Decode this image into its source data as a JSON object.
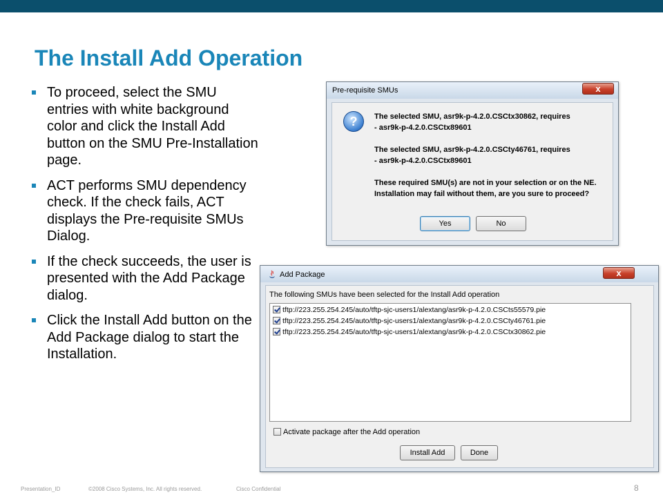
{
  "slide": {
    "title": "The Install Add Operation",
    "bullets": [
      "To proceed, select the SMU entries with white background color and click the Install Add button on the SMU Pre-Installation page.",
      "ACT performs SMU dependency check.  If the check fails, ACT displays the Pre-requisite SMUs Dialog.",
      "If the check succeeds, the user is presented with the Add Package dialog.",
      "Click the Install Add button on the Add Package dialog to start the Installation."
    ],
    "accent_color": "#1a86b8",
    "top_bar_color": "#0b4f6c"
  },
  "prereq_dialog": {
    "title": "Pre-requisite SMUs",
    "close_label": "x",
    "icon": "question-icon",
    "icon_glyph": "?",
    "messages": [
      "The selected SMU, asr9k-p-4.2.0.CSCtx30862, requires",
      " - asr9k-p-4.2.0.CSCtx89601",
      "The selected SMU, asr9k-p-4.2.0.CSCty46761, requires",
      " - asr9k-p-4.2.0.CSCtx89601",
      "These required SMU(s) are not in your selection or on the NE.",
      "Installation may fail without them, are you sure to proceed?"
    ],
    "yes_label": "Yes",
    "no_label": "No"
  },
  "add_package_dialog": {
    "title": "Add Package",
    "close_label": "x",
    "intro": "The following SMUs have been selected for the Install Add operation",
    "items": [
      {
        "path": "tftp://223.255.254.245/auto/tftp-sjc-users1/alextang/asr9k-p-4.2.0.CSCts55579.pie",
        "checked": true
      },
      {
        "path": "tftp://223.255.254.245/auto/tftp-sjc-users1/alextang/asr9k-p-4.2.0.CSCty46761.pie",
        "checked": true
      },
      {
        "path": "tftp://223.255.254.245/auto/tftp-sjc-users1/alextang/asr9k-p-4.2.0.CSCtx30862.pie",
        "checked": true
      }
    ],
    "activate_label": "Activate package after the Add operation",
    "activate_checked": false,
    "install_add_label": "Install Add",
    "done_label": "Done"
  },
  "footer": {
    "presentation_id": "Presentation_ID",
    "copyright": "©2008 Cisco Systems, Inc. All rights reserved.",
    "confidential": "Cisco Confidential",
    "page_number": "8"
  }
}
